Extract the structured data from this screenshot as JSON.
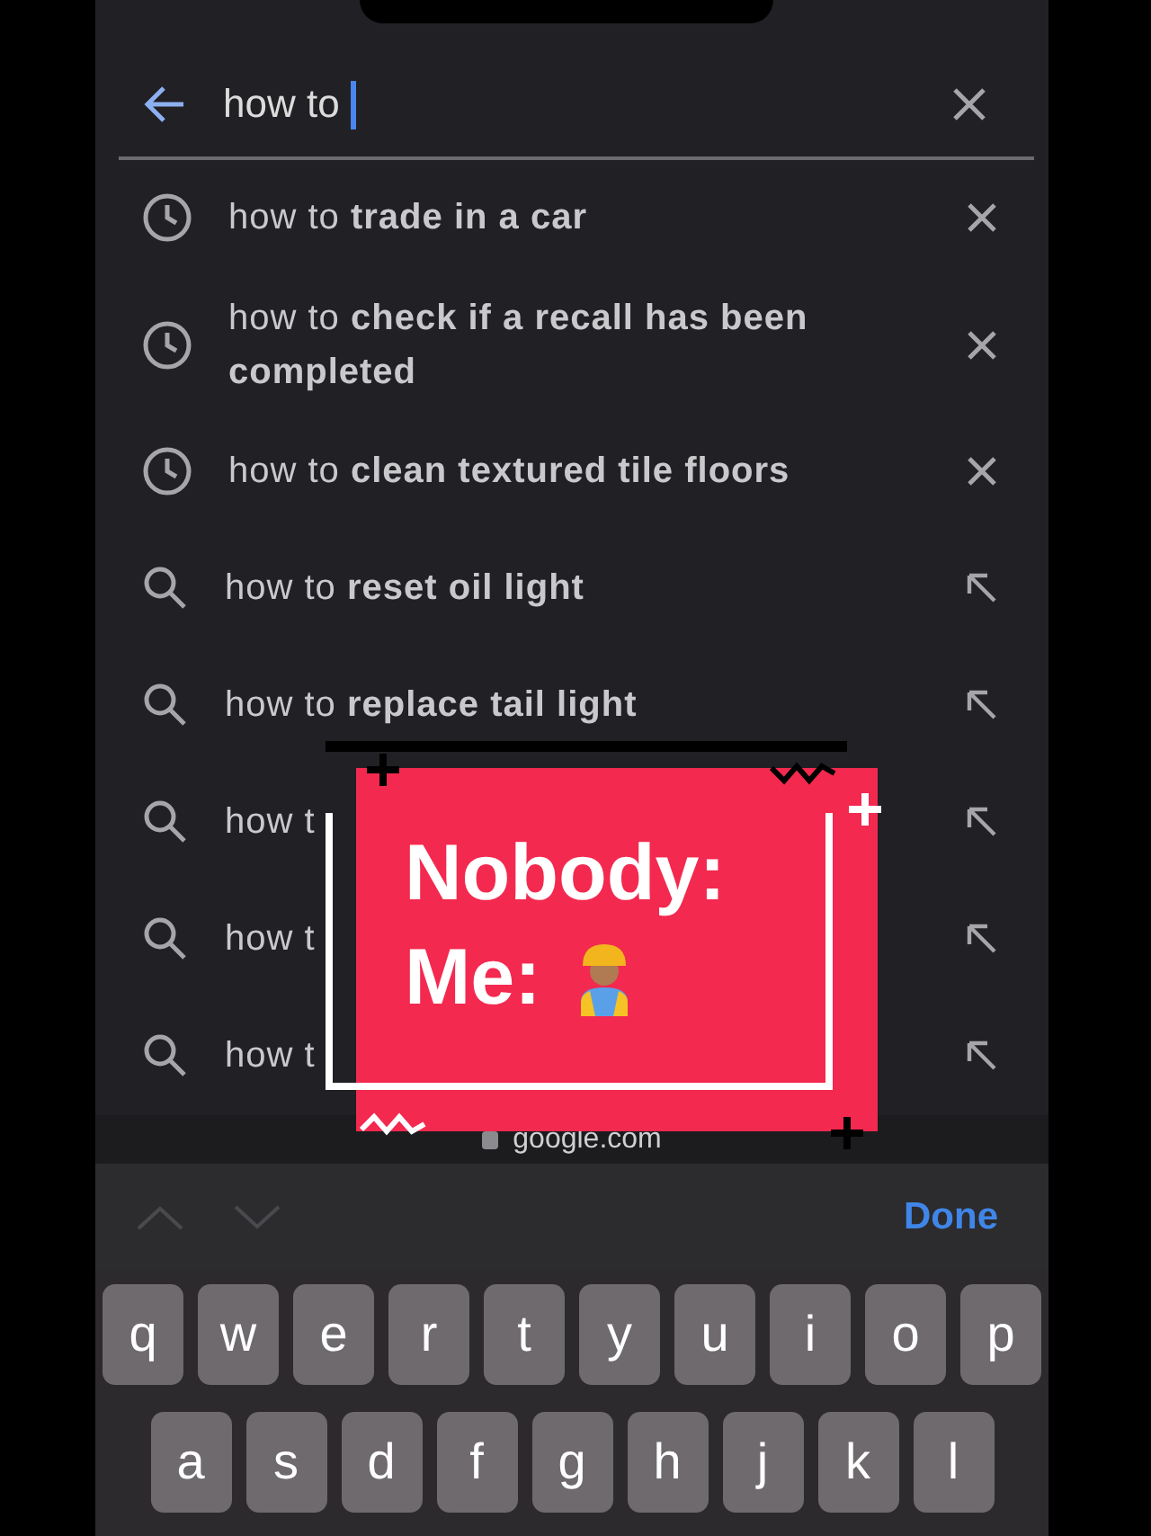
{
  "search": {
    "value": "how to "
  },
  "suggestions": [
    {
      "kind": "history",
      "text": "how to **trade in a car**"
    },
    {
      "kind": "history",
      "text": "how to **check if a recall has been completed**"
    },
    {
      "kind": "history",
      "text": "how to **clean textured tile floors**"
    },
    {
      "kind": "search",
      "text": "how to **reset oil light**"
    },
    {
      "kind": "search",
      "text": "how to **replace tail light**"
    },
    {
      "kind": "search",
      "text": "how t"
    },
    {
      "kind": "search",
      "text": "how t"
    },
    {
      "kind": "search",
      "text": "how t"
    }
  ],
  "address": "google.com",
  "sticker": {
    "lines": [
      "Nobody:",
      "Me:"
    ]
  },
  "accessory": {
    "prev_disabled": true,
    "next_disabled": true,
    "done": "Done"
  },
  "keyboard": {
    "rows": [
      [
        "q",
        "w",
        "e",
        "r",
        "t",
        "y",
        "u",
        "i",
        "o",
        "p"
      ],
      [
        "a",
        "s",
        "d",
        "f",
        "g",
        "h",
        "j",
        "k",
        "l"
      ]
    ]
  }
}
